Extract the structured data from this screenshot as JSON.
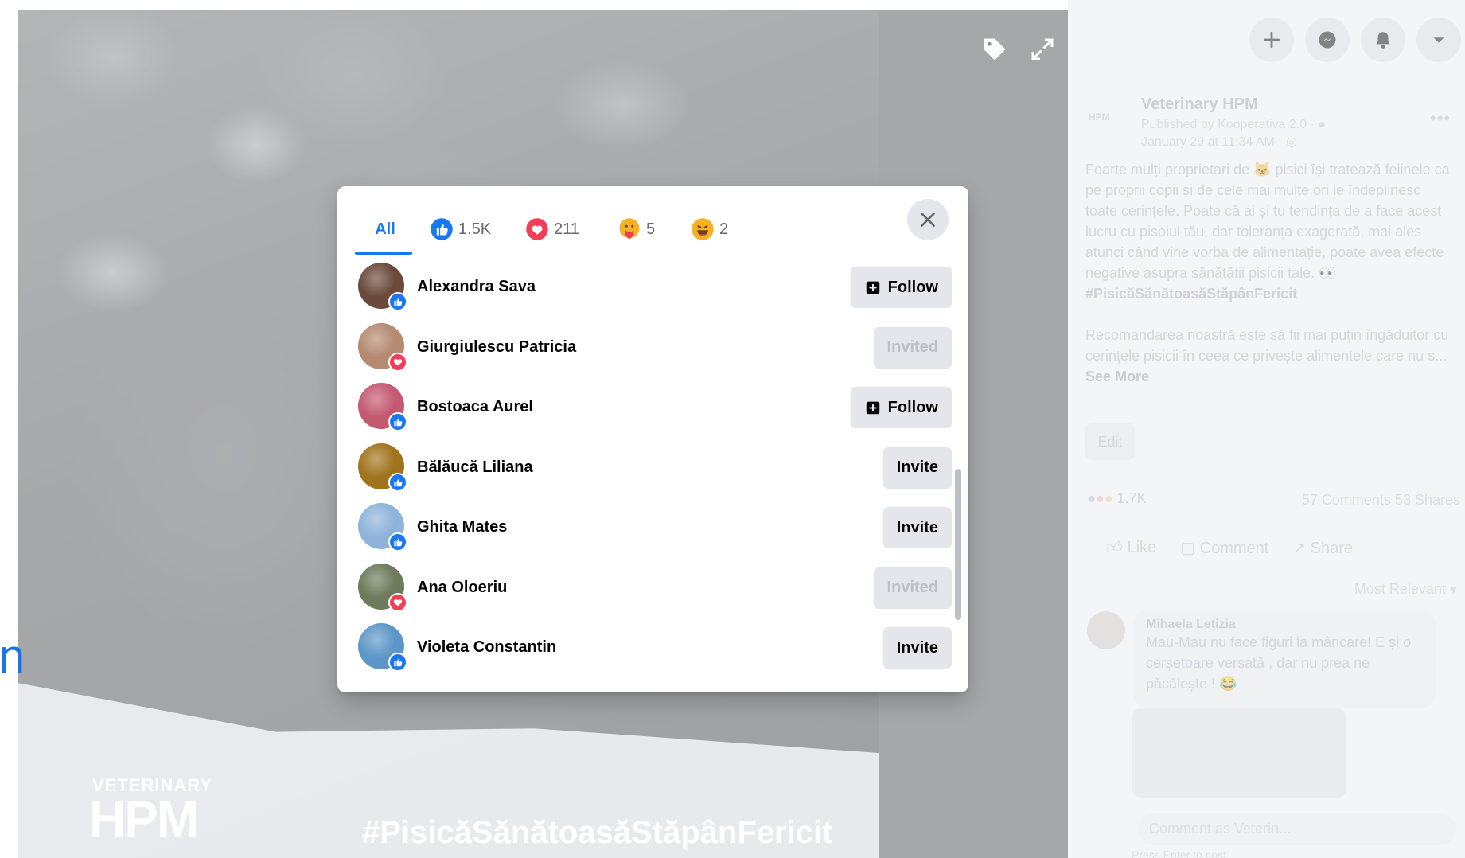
{
  "viewer": {
    "hashtag": "#PisicăSănătoasăStăpânFericit",
    "brand_top": "VETERINARY",
    "brand_main": "HPM",
    "edge_char": "n"
  },
  "topbar": {
    "create_icon": "+",
    "icons": [
      "plus-icon",
      "messenger-icon",
      "bell-icon",
      "caret-down-icon"
    ]
  },
  "post": {
    "page_name": "Veterinary HPM",
    "page_avatar": "HPM",
    "published_by": "Published by Kooperativa 2.0 · ",
    "date": "January 29 at 11:34 AM · ",
    "text_p1": "Foarte mulți proprietari de 🐱 pisici își tratează felinele ca pe proprii copii și de cele mai multe ori le îndeplinesc toate cerințele. Poate că ai și tu tendința de a face acest lucru cu pisoiul tău, dar toleranța exagerată, mai ales atunci când vine vorba de alimentație, poate avea efecte negative asupra sănătății pisicii tale. 👀",
    "text_hashtag": "#PisicăSănătoasăStăpânFericit",
    "text_p2": "Recomandarea noastră este să fii mai puțin îngăduitor cu cerințele pisicii în ceea ce privește alimentele care nu s... ",
    "see_more": "See More",
    "edit": "Edit",
    "reaction_count": "1.7K",
    "comments_shares": "57 Comments  53 Shares",
    "like": "Like",
    "comment": "Comment",
    "share": "Share",
    "most_relevant": "Most Relevant ▾",
    "commenter_name": "Mihaela Letizia",
    "comment_text": "Mau-Mau nu face figuri la mâncare! E și o cerșetoare versată , dar nu prea ne păcălește ! 😂",
    "comment_placeholder": "Comment as Veterin...",
    "press_enter": "Press Enter to post."
  },
  "dialog": {
    "tabs": [
      {
        "label": "All",
        "active": true
      },
      {
        "label": "1.5K",
        "reaction": "like"
      },
      {
        "label": "211",
        "reaction": "love"
      },
      {
        "label": "5",
        "reaction": "care"
      },
      {
        "label": "2",
        "reaction": "haha"
      }
    ],
    "people": [
      {
        "name": "Alexandra Sava",
        "reaction": "like",
        "action": "Follow",
        "action_state": "follow",
        "avatar_color": "#6b4a3c"
      },
      {
        "name": "Giurgiulescu Patricia",
        "reaction": "love",
        "action": "Invited",
        "action_state": "invited",
        "avatar_color": "#b58a70"
      },
      {
        "name": "Bostoaca Aurel",
        "reaction": "like",
        "action": "Follow",
        "action_state": "follow",
        "avatar_color": "#c45a72"
      },
      {
        "name": "Bălăucă Liliana",
        "reaction": "like",
        "action": "Invite",
        "action_state": "invite",
        "avatar_color": "#a0741e"
      },
      {
        "name": "Ghita Mates",
        "reaction": "like",
        "action": "Invite",
        "action_state": "invite",
        "avatar_color": "#8fb3d9"
      },
      {
        "name": "Ana Oloeriu",
        "reaction": "love",
        "action": "Invited",
        "action_state": "invited",
        "avatar_color": "#6d7b5a"
      },
      {
        "name": "Violeta Constantin",
        "reaction": "like",
        "action": "Invite",
        "action_state": "invite",
        "avatar_color": "#5d97c7"
      }
    ]
  },
  "colors": {
    "accent": "#1877f2",
    "love": "#f33e58",
    "button_bg": "#e4e6eb"
  }
}
